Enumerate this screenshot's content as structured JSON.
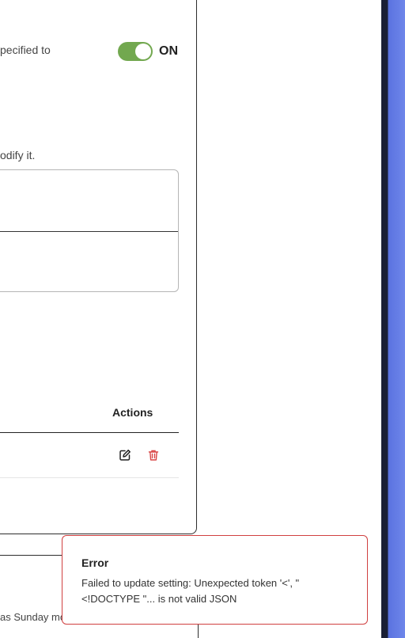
{
  "settings": {
    "toggle_description": "pecified to",
    "toggle_state": "ON",
    "modify_hint": "odify it."
  },
  "table": {
    "actions_header": "Actions",
    "row_actions": [
      "edit-icon",
      "trash-icon"
    ]
  },
  "footer": {
    "text": "as Sunday mo"
  },
  "toast": {
    "title": "Error",
    "message": "Failed to update setting: Unexpected token '<', \"\n<!DOCTYPE \"... is not valid JSON"
  },
  "colors": {
    "toggle_on": "#72a84f",
    "error_border": "#d04040",
    "delete_icon": "#d94545",
    "accent_band": "#5b73e0"
  }
}
